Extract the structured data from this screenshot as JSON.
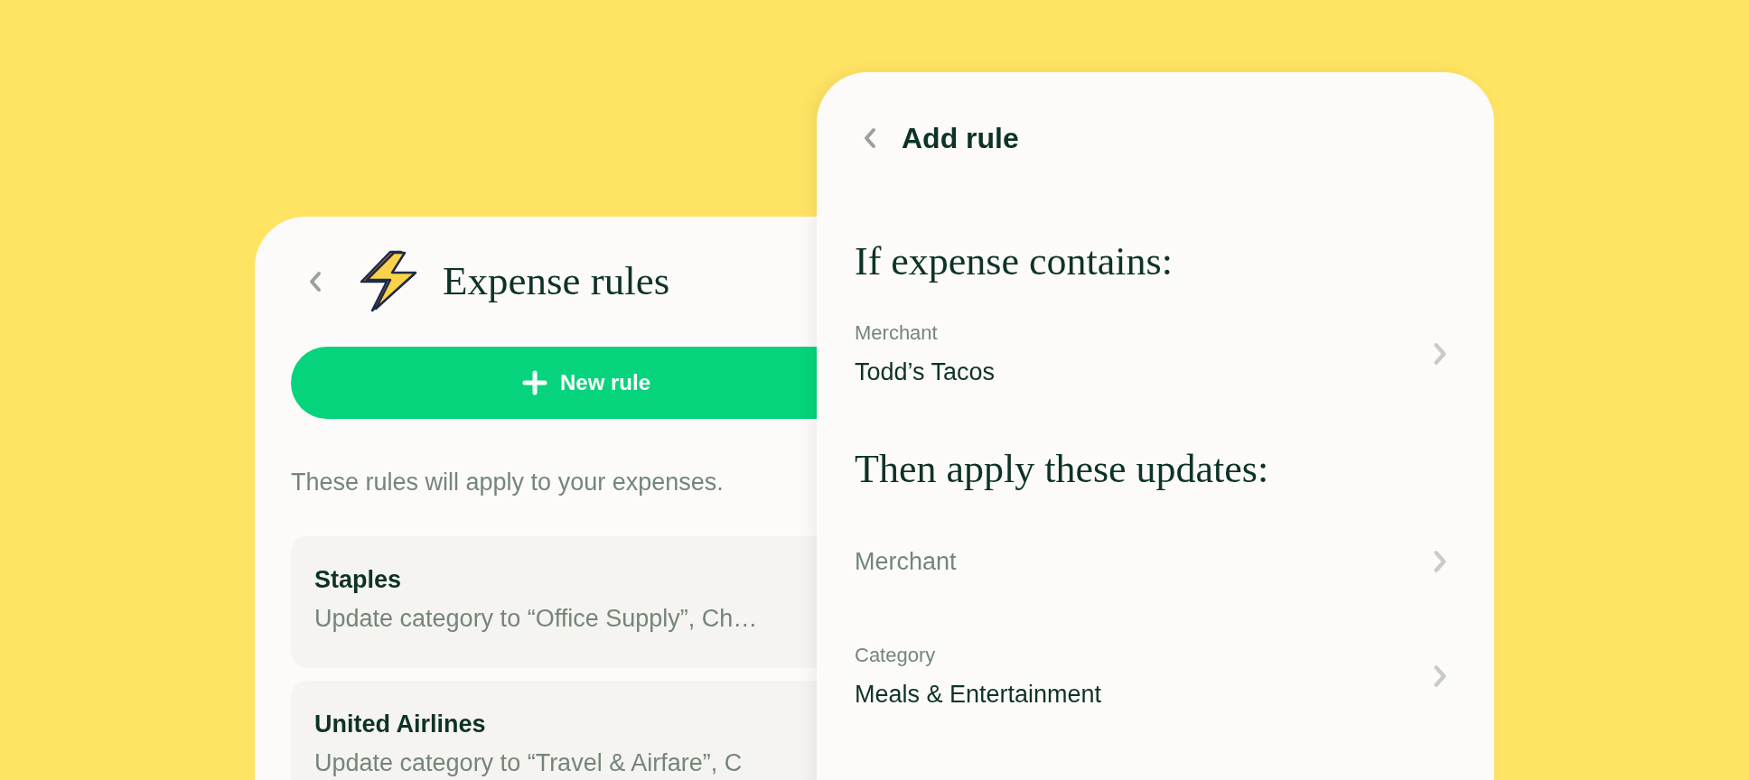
{
  "expense_rules": {
    "title": "Expense rules",
    "new_rule_button": "New rule",
    "description": "These rules will apply to your expenses.",
    "rules": [
      {
        "name": "Staples",
        "summary": "Update category to “Office Supply”, Ch…"
      },
      {
        "name": "United Airlines",
        "summary": "Update category to “Travel & Airfare”, C"
      }
    ]
  },
  "add_rule": {
    "title": "Add rule",
    "conditions": {
      "heading": "If expense contains:",
      "fields": [
        {
          "label": "Merchant",
          "value": "Todd’s Tacos"
        }
      ]
    },
    "updates": {
      "heading": "Then apply these updates:",
      "fields": [
        {
          "placeholder": "Merchant"
        },
        {
          "label": "Category",
          "value": "Meals & Entertainment"
        }
      ]
    }
  }
}
